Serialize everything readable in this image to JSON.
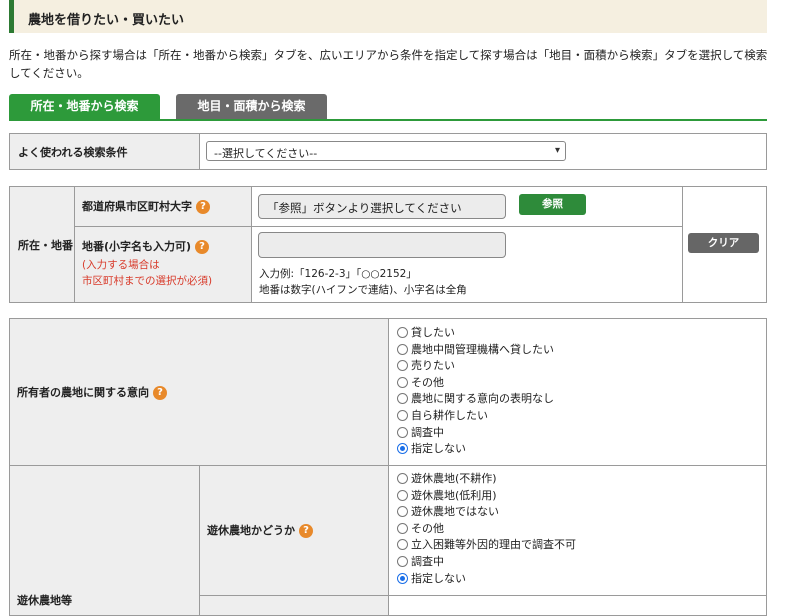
{
  "header": {
    "title": "農地を借りたい・買いたい"
  },
  "intro": "所在・地番から探す場合は「所在・地番から検索」タブを、広いエリアから条件を指定して探す場合は「地目・面積から検索」タブを選択して検索してください。",
  "tabs": [
    {
      "label": "所在・地番から検索",
      "active": true
    },
    {
      "label": "地目・面積から検索",
      "active": false
    }
  ],
  "common_search": {
    "label": "よく使われる検索条件",
    "selected": "--選択してください--"
  },
  "location": {
    "section_label": "所在・地番",
    "pref_label": "都道府県市区町村大字",
    "pref_placeholder": "「参照」ボタンより選択してください",
    "browse_button": "参照",
    "lot_label": "地番(小字名も入力可)",
    "lot_note_line1": "(入力する場合は",
    "lot_note_line2": "市区町村までの選択が必須)",
    "lot_value": "",
    "example": "入力例:「126-2-3」「○○2152」",
    "hint": "地番は数字(ハイフンで連結)、小字名は全角",
    "clear_button": "クリア"
  },
  "owner_intent": {
    "label": "所有者の農地に関する意向",
    "options": [
      "貸したい",
      "農地中間管理機構へ貸したい",
      "売りたい",
      "その他",
      "農地に関する意向の表明なし",
      "自ら耕作したい",
      "調査中",
      "指定しない"
    ],
    "selected": "指定しない"
  },
  "idle_land": {
    "outer_label": "遊休農地等",
    "label": "遊休農地かどうか",
    "options": [
      "遊休農地(不耕作)",
      "遊休農地(低利用)",
      "遊休農地ではない",
      "その他",
      "立入困難等外因的理由で調査不可",
      "調査中",
      "指定しない"
    ],
    "selected": "指定しない"
  },
  "colors": {
    "accent_green": "#2d9a3a",
    "help_orange": "#e8892a",
    "note_red": "#d83a2a",
    "radio_blue": "#1a6ee8"
  },
  "icons": {
    "help": "question-circle-icon",
    "dropdown": "chevron-down-icon"
  }
}
